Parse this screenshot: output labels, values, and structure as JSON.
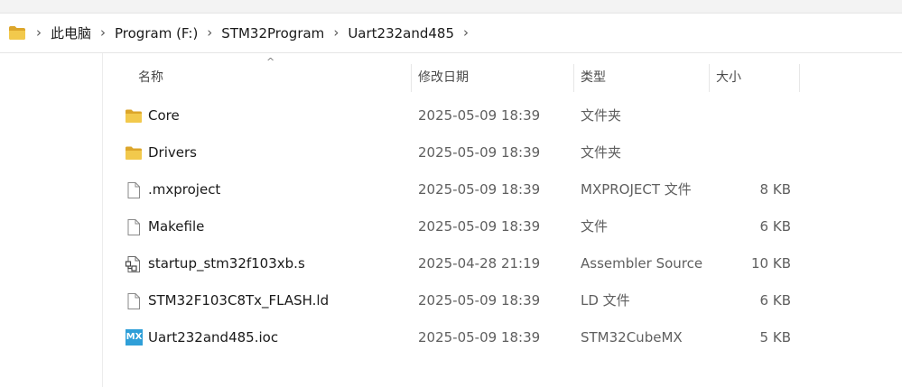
{
  "breadcrumb": [
    "此电脑",
    "Program (F:)",
    "STM32Program",
    "Uart232and485"
  ],
  "columns": {
    "name": "名称",
    "date": "修改日期",
    "type": "类型",
    "size": "大小"
  },
  "sort": {
    "column": "name",
    "direction": "ascending"
  },
  "files": [
    {
      "name": "Core",
      "date": "2025-05-09 18:39",
      "type": "文件夹",
      "size": "",
      "icon": "folder-icon"
    },
    {
      "name": "Drivers",
      "date": "2025-05-09 18:39",
      "type": "文件夹",
      "size": "",
      "icon": "folder-icon"
    },
    {
      "name": ".mxproject",
      "date": "2025-05-09 18:39",
      "type": "MXPROJECT 文件",
      "size": "8 KB",
      "icon": "file-icon"
    },
    {
      "name": "Makefile",
      "date": "2025-05-09 18:39",
      "type": "文件",
      "size": "6 KB",
      "icon": "file-icon"
    },
    {
      "name": "startup_stm32f103xb.s",
      "date": "2025-04-28 21:19",
      "type": "Assembler Source",
      "size": "10 KB",
      "icon": "assembler-file-icon"
    },
    {
      "name": "STM32F103C8Tx_FLASH.ld",
      "date": "2025-05-09 18:39",
      "type": "LD 文件",
      "size": "6 KB",
      "icon": "file-icon"
    },
    {
      "name": "Uart232and485.ioc",
      "date": "2025-05-09 18:39",
      "type": "STM32CubeMX",
      "size": "5 KB",
      "icon": "stm32cubemx-icon",
      "icon_text": "MX"
    }
  ],
  "colors": {
    "folder": "#f2c94c",
    "folder_dark": "#dca62b",
    "mx_badge": "#2f9fd8",
    "secondary_text": "#5f5f5f"
  }
}
